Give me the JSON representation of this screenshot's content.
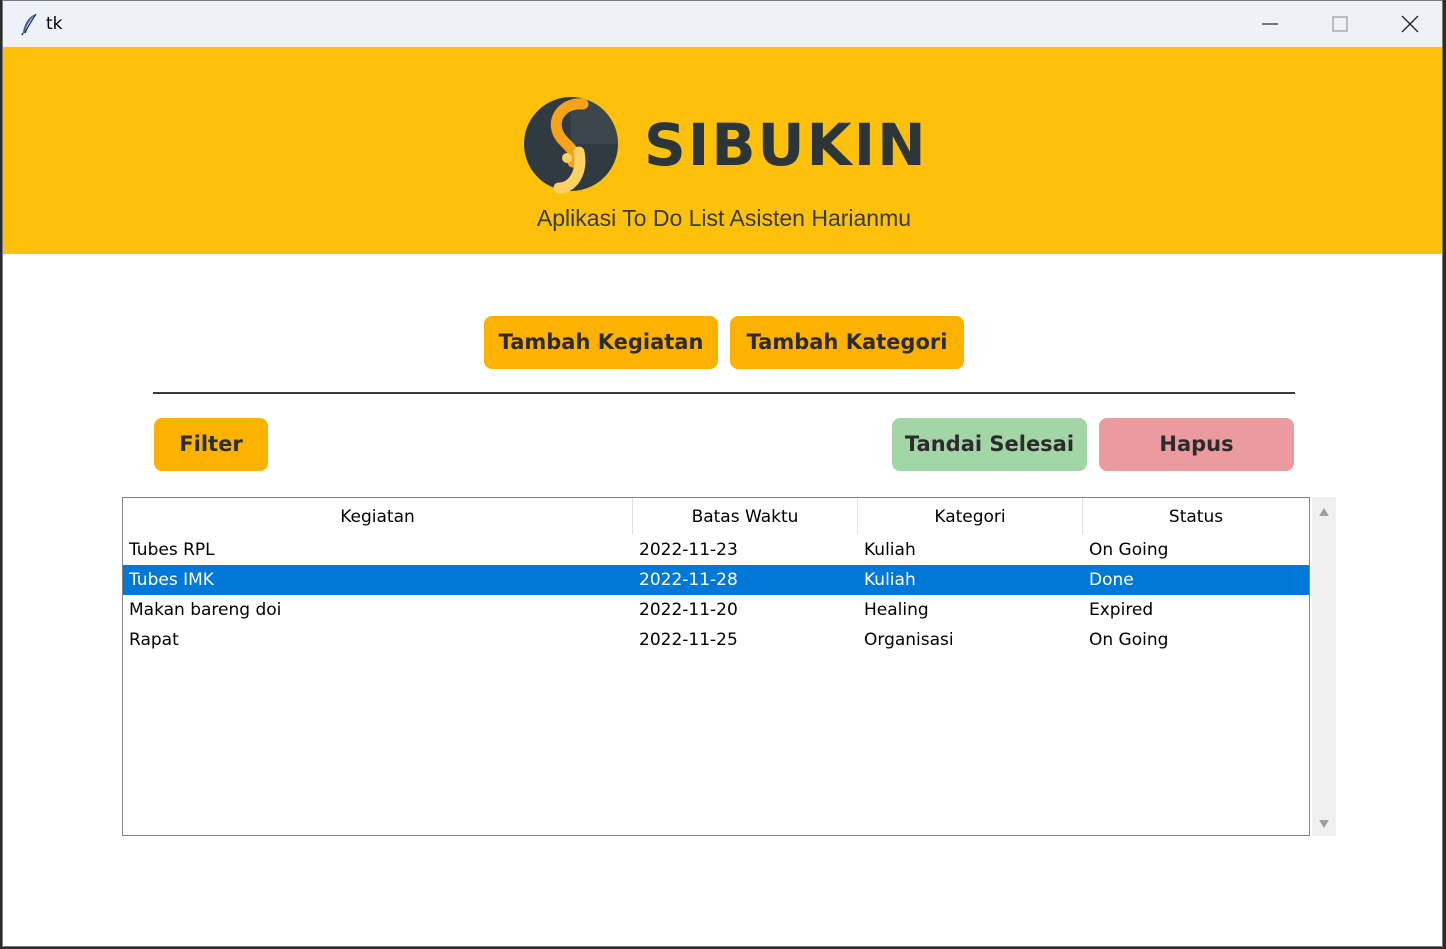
{
  "window": {
    "title": "tk"
  },
  "header": {
    "brand": "SIBUKIN",
    "tagline": "Aplikasi To Do List Asisten Harianmu",
    "bg_color": "#fdc10b"
  },
  "actions": {
    "add_activity": "Tambah Kegiatan",
    "add_category": "Tambah Kategori",
    "filter": "Filter",
    "mark_done": "Tandai Selesai",
    "delete": "Hapus"
  },
  "table": {
    "columns": [
      "Kegiatan",
      "Batas Waktu",
      "Kategori",
      "Status"
    ],
    "selected_row": 1,
    "rows": [
      {
        "activity": "Tubes RPL",
        "deadline": "2022-11-23",
        "category": "Kuliah",
        "status": "On Going"
      },
      {
        "activity": "Tubes IMK",
        "deadline": "2022-11-28",
        "category": "Kuliah",
        "status": "Done"
      },
      {
        "activity": "Makan bareng doi",
        "deadline": "2022-11-20",
        "category": "Healing",
        "status": "Expired"
      },
      {
        "activity": "Rapat",
        "deadline": "2022-11-25",
        "category": "Organisasi",
        "status": "On Going"
      }
    ]
  },
  "colors": {
    "accent": "#fdb200",
    "done_button": "#a3d6a6",
    "delete_button": "#eb9a9d",
    "selection": "#0078d7"
  },
  "icons": {
    "window": "feather-icon",
    "minimize": "minimize-icon",
    "maximize": "maximize-icon",
    "close": "close-icon",
    "scroll_up": "triangle-up-icon",
    "scroll_down": "triangle-down-icon"
  }
}
